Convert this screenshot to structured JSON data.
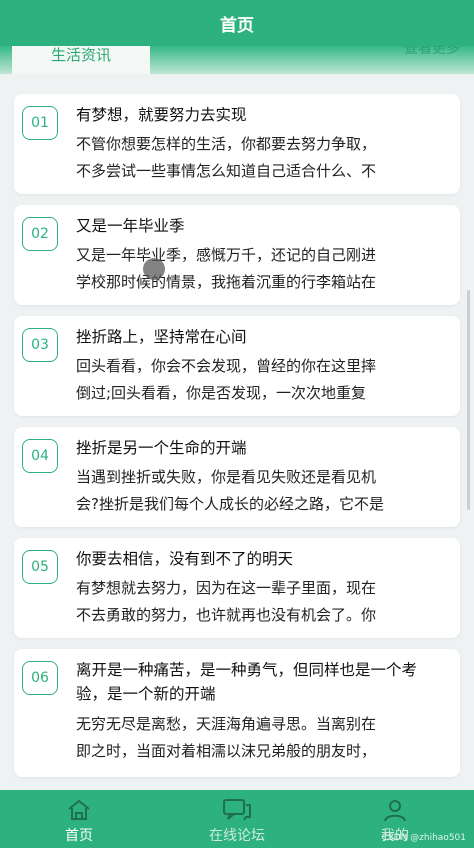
{
  "header": {
    "title": "首页"
  },
  "tabs": {
    "active_label": "生活资讯",
    "more_label": "查看更多"
  },
  "articles": [
    {
      "num": "01",
      "title": "有梦想，就要努力去实现",
      "line1": "不管你想要怎样的生活，你都要去努力争取，",
      "line2": "不多尝试一些事情怎么知道自己适合什么、不"
    },
    {
      "num": "02",
      "title": "又是一年毕业季",
      "line1": "又是一年毕业季，感慨万千，还记的自己刚进",
      "line2": "学校那时候的情景，我拖着沉重的行李箱站在"
    },
    {
      "num": "03",
      "title": "挫折路上，坚持常在心间",
      "line1": "回头看看，你会不会发现，曾经的你在这里摔",
      "line2": "倒过;回头看看，你是否发现，一次次地重复"
    },
    {
      "num": "04",
      "title": "挫折是另一个生命的开端",
      "line1": "当遇到挫折或失败，你是看见失败还是看见机",
      "line2": "会?挫折是我们每个人成长的必经之路，它不是"
    },
    {
      "num": "05",
      "title": "你要去相信，没有到不了的明天",
      "line1": "有梦想就去努力，因为在这一辈子里面，现在",
      "line2": "不去勇敢的努力，也许就再也没有机会了。你"
    },
    {
      "num": "06",
      "title": "离开是一种痛苦，是一种勇气，但同样也是一个考验，是一个新的开端",
      "line1": "无穷无尽是离愁，天涯海角遍寻思。当离别在",
      "line2": "即之时，当面对着相濡以沫兄弟般的朋友时，"
    }
  ],
  "nav": [
    {
      "label": "首页",
      "icon": "home-icon"
    },
    {
      "label": "在线论坛",
      "icon": "chat-icon"
    },
    {
      "label": "我的",
      "icon": "user-icon"
    }
  ],
  "watermark": "CSDN @zhihao501",
  "colors": {
    "primary": "#2db27f"
  }
}
